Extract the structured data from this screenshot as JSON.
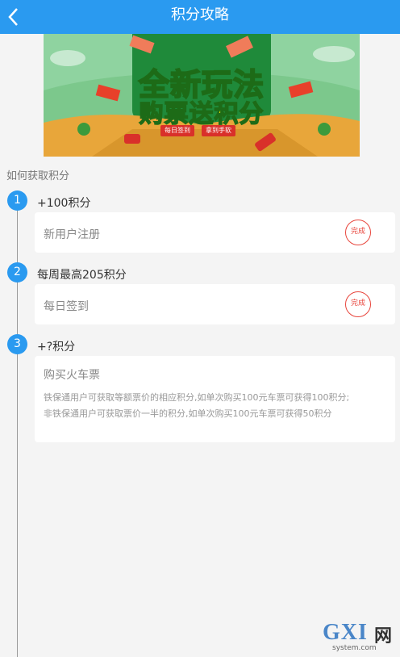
{
  "header": {
    "title": "积分攻略",
    "back_icon": "chevron-left-icon"
  },
  "banner": {
    "line1": "全新玩法",
    "line2": "购票送积分",
    "tag_left": "每日签到",
    "tag_right": "拿到手软"
  },
  "section": {
    "label": "如何获取积分"
  },
  "steps": [
    {
      "number": "1",
      "title": "+100积分",
      "item": "新用户注册",
      "status": "完成"
    },
    {
      "number": "2",
      "title": "每周最高205积分",
      "item": "每日签到",
      "status": "完成"
    },
    {
      "number": "3",
      "title": "+?积分",
      "item": "购买火车票",
      "desc_line1": "铁保通用户可获取等额票价的相应积分,如单次购买100元车票可获得100积分;",
      "desc_line2": "非铁保通用户可获取票价一半的积分,如单次购买100元车票可获得50积分"
    }
  ],
  "watermark": {
    "brand": "GXI",
    "cn": "网",
    "domain": "system.com"
  },
  "colors": {
    "header_bg": "#2a9af0",
    "step_circle": "#2a9af0",
    "badge": "#e8453c"
  }
}
